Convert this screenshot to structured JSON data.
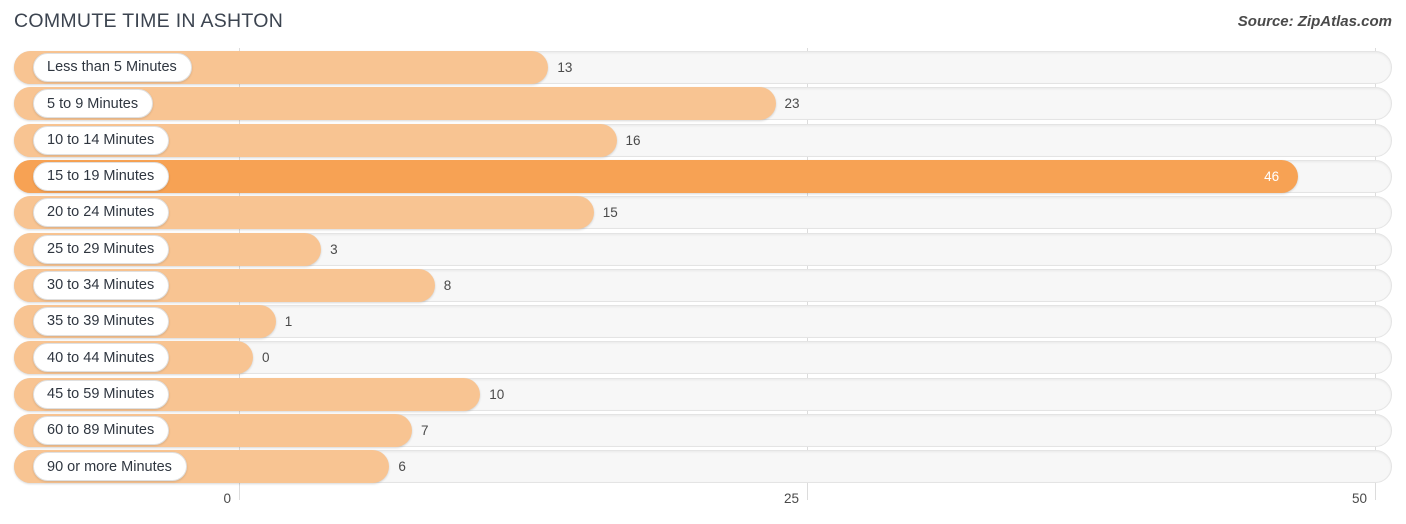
{
  "header": {
    "title": "COMMUTE TIME IN ASHTON",
    "source": "Source: ZipAtlas.com"
  },
  "colors": {
    "bar": "#F8C492",
    "bar_highlight": "#F7A254",
    "track": "#F7F7F7",
    "grid": "#DCDCDC",
    "text": "#4A4A4A",
    "title": "#3C4450"
  },
  "chart_data": {
    "type": "bar",
    "orientation": "horizontal",
    "title": "COMMUTE TIME IN ASHTON",
    "xlabel": "",
    "ylabel": "",
    "xlim": [
      0,
      50
    ],
    "grid": true,
    "legend": "none",
    "ticks": [
      {
        "label": "0",
        "value": 0
      },
      {
        "label": "25",
        "value": 25
      },
      {
        "label": "50",
        "value": 50
      }
    ],
    "categories": [
      "Less than 5 Minutes",
      "5 to 9 Minutes",
      "10 to 14 Minutes",
      "15 to 19 Minutes",
      "20 to 24 Minutes",
      "25 to 29 Minutes",
      "30 to 34 Minutes",
      "35 to 39 Minutes",
      "40 to 44 Minutes",
      "45 to 59 Minutes",
      "60 to 89 Minutes",
      "90 or more Minutes"
    ],
    "values": [
      13,
      23,
      16,
      46,
      15,
      3,
      8,
      1,
      0,
      10,
      7,
      6
    ],
    "highlight_index": 3,
    "rows": [
      {
        "label": "Less than 5 Minutes",
        "value": 13,
        "value_label": "13",
        "highlight": false
      },
      {
        "label": "5 to 9 Minutes",
        "value": 23,
        "value_label": "23",
        "highlight": false
      },
      {
        "label": "10 to 14 Minutes",
        "value": 16,
        "value_label": "16",
        "highlight": false
      },
      {
        "label": "15 to 19 Minutes",
        "value": 46,
        "value_label": "46",
        "highlight": true
      },
      {
        "label": "20 to 24 Minutes",
        "value": 15,
        "value_label": "15",
        "highlight": false
      },
      {
        "label": "25 to 29 Minutes",
        "value": 3,
        "value_label": "3",
        "highlight": false
      },
      {
        "label": "30 to 34 Minutes",
        "value": 8,
        "value_label": "8",
        "highlight": false
      },
      {
        "label": "35 to 39 Minutes",
        "value": 1,
        "value_label": "1",
        "highlight": false
      },
      {
        "label": "40 to 44 Minutes",
        "value": 0,
        "value_label": "0",
        "highlight": false
      },
      {
        "label": "45 to 59 Minutes",
        "value": 10,
        "value_label": "10",
        "highlight": false
      },
      {
        "label": "60 to 89 Minutes",
        "value": 7,
        "value_label": "7",
        "highlight": false
      },
      {
        "label": "90 or more Minutes",
        "value": 6,
        "value_label": "6",
        "highlight": false
      }
    ]
  }
}
